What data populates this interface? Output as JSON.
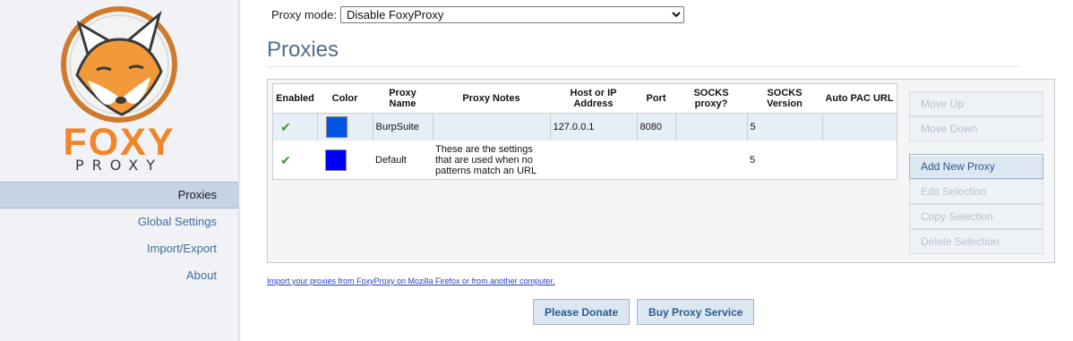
{
  "sidebar": {
    "logo": {
      "word": "FOXY",
      "sub": "PROXY"
    },
    "items": [
      {
        "label": "Proxies",
        "active": true
      },
      {
        "label": "Global Settings",
        "active": false
      },
      {
        "label": "Import/Export",
        "active": false
      },
      {
        "label": "About",
        "active": false
      }
    ]
  },
  "proxy_mode": {
    "label": "Proxy mode:",
    "selected": "Disable FoxyProxy"
  },
  "page_title": "Proxies",
  "table": {
    "headers": {
      "enabled": "Enabled",
      "color": "Color",
      "name": "Proxy Name",
      "notes": "Proxy Notes",
      "host": "Host or IP Address",
      "port": "Port",
      "socks_proxy": "SOCKS proxy?",
      "socks_version": "SOCKS Version",
      "auto_pac": "Auto PAC URL"
    },
    "rows": [
      {
        "enabled": "✔",
        "color": "#0055e6",
        "name": "BurpSuite",
        "notes": "",
        "host": "127.0.0.1",
        "port": "8080",
        "socks_proxy": "",
        "socks_version": "5",
        "auto_pac": ""
      },
      {
        "enabled": "✔",
        "color": "#0000ff",
        "name": "Default",
        "notes": "These are the settings that are used when no patterns match an URL",
        "host": "",
        "port": "",
        "socks_proxy": "",
        "socks_version": "5",
        "auto_pac": ""
      }
    ]
  },
  "buttons": {
    "move_up": "Move Up",
    "move_down": "Move Down",
    "add_new": "Add New Proxy",
    "edit": "Edit Selection",
    "copy": "Copy Selection",
    "delete": "Delete Selection"
  },
  "import_link": "Import your proxies from FoxyProxy on Mozilla Firefox or from another computer.",
  "footer": {
    "donate": "Please Donate",
    "buy": "Buy Proxy Service"
  },
  "colors": {
    "accent": "#516c8c",
    "logo_orange": "#f0852a"
  }
}
